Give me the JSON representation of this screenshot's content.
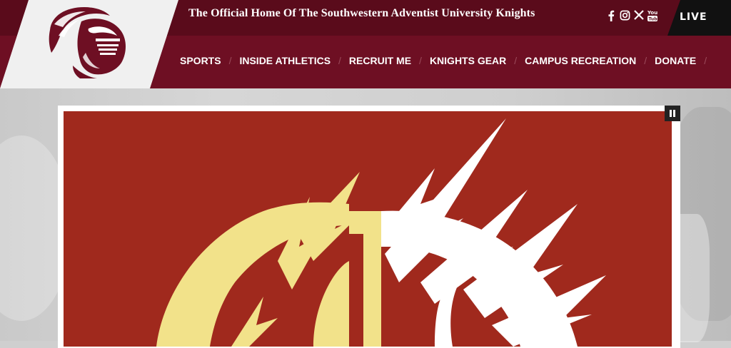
{
  "header": {
    "title": "The Official Home Of The Southwestern Adventist University Knights",
    "live_label": "LIVE"
  },
  "social": {
    "items": [
      {
        "name": "facebook-icon"
      },
      {
        "name": "instagram-icon"
      },
      {
        "name": "x-icon"
      },
      {
        "name": "youtube-icon"
      }
    ]
  },
  "nav": {
    "items": [
      {
        "label": "SPORTS"
      },
      {
        "label": "INSIDE ATHLETICS"
      },
      {
        "label": "RECRUIT ME"
      },
      {
        "label": "KNIGHTS GEAR"
      },
      {
        "label": "CAMPUS RECREATION"
      },
      {
        "label": "DONATE"
      }
    ]
  },
  "colors": {
    "brand_maroon": "#6e0f23",
    "topbar_maroon": "#5a0b1b",
    "slide_red": "#a0291d",
    "logo_gold": "#f2e28a"
  }
}
